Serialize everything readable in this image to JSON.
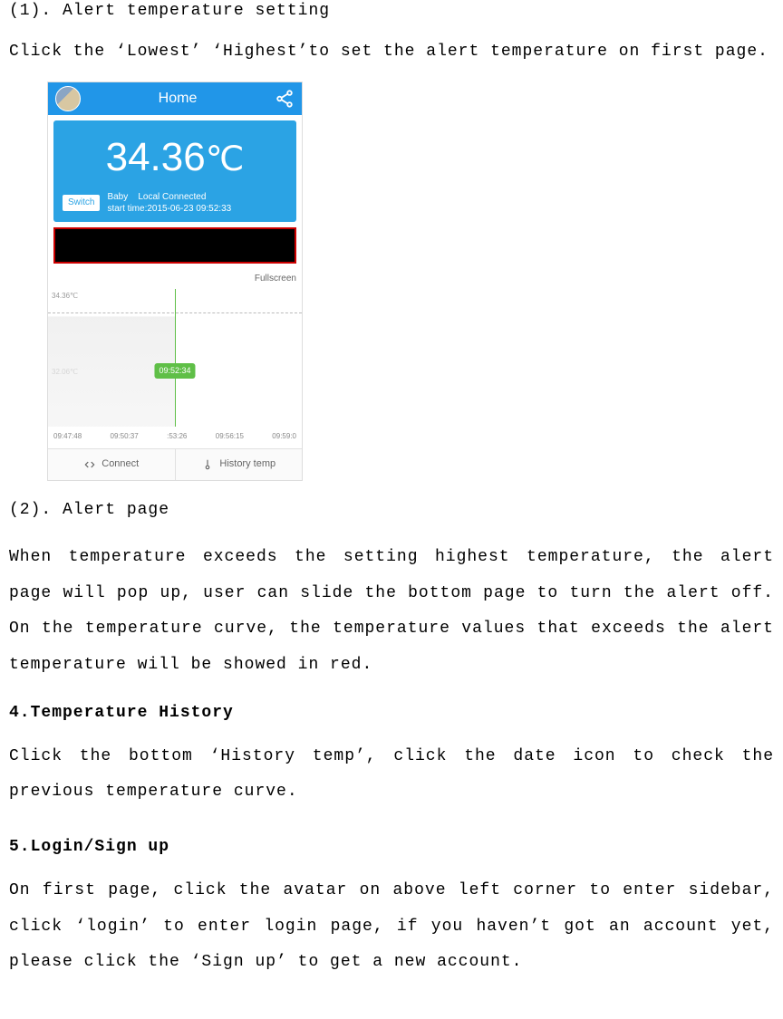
{
  "doc": {
    "h_1_1": "(1). Alert temperature setting",
    "p_1_1": "Click the ‘Lowest’ ‘Highest’to set the alert temperature on first page.",
    "h_1_2": "(2). Alert page",
    "p_1_2": "When temperature exceeds the setting highest temperature, the alert page will pop up, user can slide the bottom page to turn the alert off. On the temperature curve, the temperature values that exceeds the alert temperature will be showed in red.",
    "h_4": "4.Temperature History",
    "p_4": "Click the bottom ‘History temp’, click the date icon to check the previous temperature curve.",
    "h_5": "5.Login/Sign up",
    "p_5": "On first page, click the avatar on above left corner to enter sidebar, click ‘login’ to enter login page, if you haven’t got an account yet, please click the ‘Sign up’ to get a new account."
  },
  "shot": {
    "header_title": "Home",
    "temp_value": "34.36",
    "temp_unit": "℃",
    "switch_label": "Switch",
    "sub_label": "Baby",
    "sub_connected": "Local Connected",
    "sub_start": "start time:2015-06-23 09:52:33",
    "fullscreen": "Fullscreen",
    "y_top": "34.36℃",
    "y_mid": "32.06℃",
    "time_badge": "09:52:34",
    "x": [
      "09:47:48",
      "09:50:37",
      ":53:26",
      "09:56:15",
      "09:59:0"
    ],
    "tab_connect": "Connect",
    "tab_history": "History temp"
  }
}
